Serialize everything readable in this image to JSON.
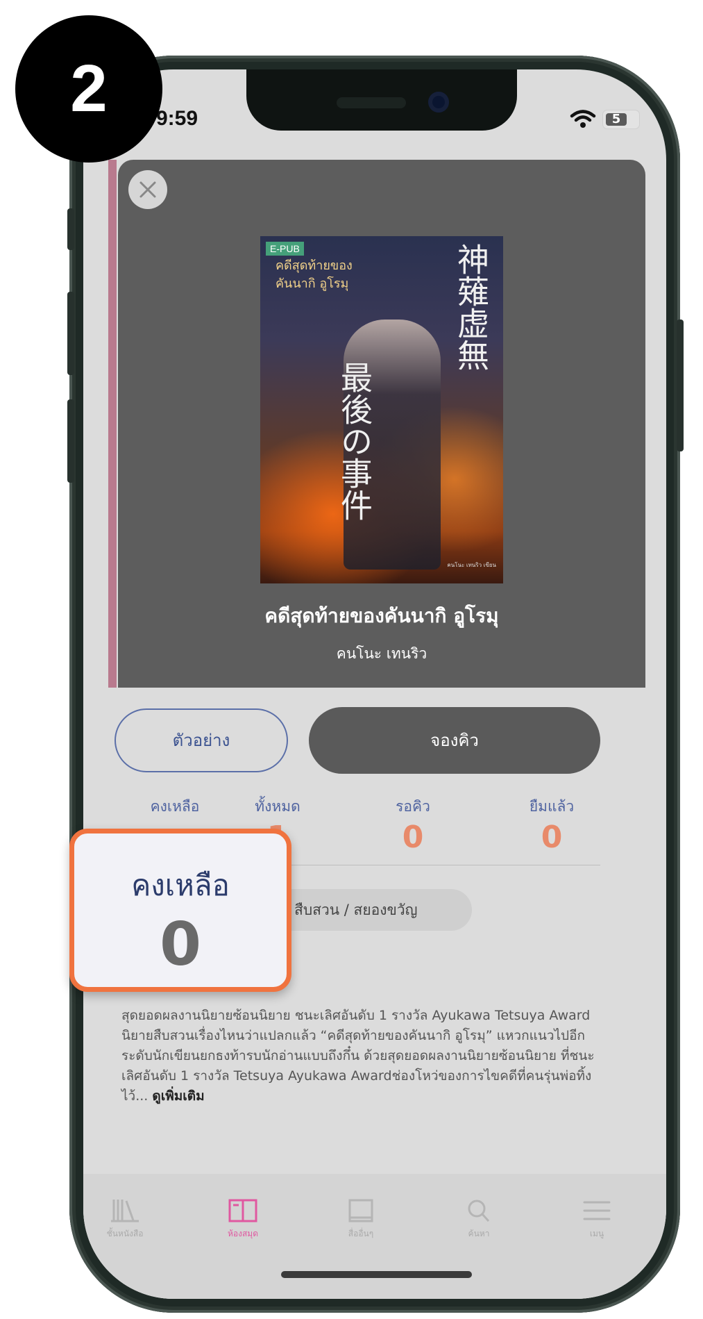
{
  "step_badge": "2",
  "status_bar": {
    "time": "9:59",
    "battery": "5"
  },
  "book": {
    "cover_badge": "E-PUB",
    "cover_title": "คดีสุดท้ายของ คันนากิ อูโรมุ",
    "cover_japanese_right": "神薙虚無",
    "cover_japanese_left": "最後の事件",
    "cover_credit": "คนโนะ เทนริว เขียน",
    "title": "คดีสุดท้ายของคันนากิ อูโรมุ",
    "author": "คนโนะ เทนริว"
  },
  "actions": {
    "sample": "ตัวอย่าง",
    "reserve": "จองคิว"
  },
  "stats": [
    {
      "label": "คงเหลือ",
      "value": ""
    },
    {
      "label": "ทั้งหมด",
      "value": "1"
    },
    {
      "label": "รอคิว",
      "value": "0"
    },
    {
      "label": "ยืมแล้ว",
      "value": "0"
    }
  ],
  "genre": "สืบสวน / สยองขวัญ",
  "synopsis": {
    "text": "สุดยอดผลงานนิยายซ้อนนิยาย ชนะเลิศอันดับ 1 รางวัล Ayukawa Tetsuya Award นิยายสืบสวนเรื่องไหนว่าแปลกแล้ว “คดีสุดท้ายของคันนากิ อูโรมุ” แหวกแนวไปอีกระดับนักเขียนยกธงท้ารบนักอ่านแบบถึงกึ๋น ด้วยสุดยอดผลงานนิยายซ้อนนิยาย ที่ชนะเลิศอันดับ 1 รางวัล Tetsuya Ayukawa Awardช่องโหว่ของการไขคดีที่คนรุ่นพ่อทิ้งไว้... ",
    "read_more": "ดูเพิ่มเติม"
  },
  "tabs": [
    {
      "label": "ชั้นหนังสือ",
      "icon": "bookshelf-icon"
    },
    {
      "label": "ห้องสมุด",
      "icon": "library-icon"
    },
    {
      "label": "สื่ออื่นๆ",
      "icon": "media-icon"
    },
    {
      "label": "ค้นหา",
      "icon": "search-icon"
    },
    {
      "label": "เมนู",
      "icon": "menu-icon"
    }
  ],
  "zoom_callout": {
    "label": "คงเหลือ",
    "value": "0"
  },
  "colors": {
    "accent_orange": "#f0733f",
    "active_tab": "#e058a0",
    "primary_blue": "#4f63a0"
  }
}
